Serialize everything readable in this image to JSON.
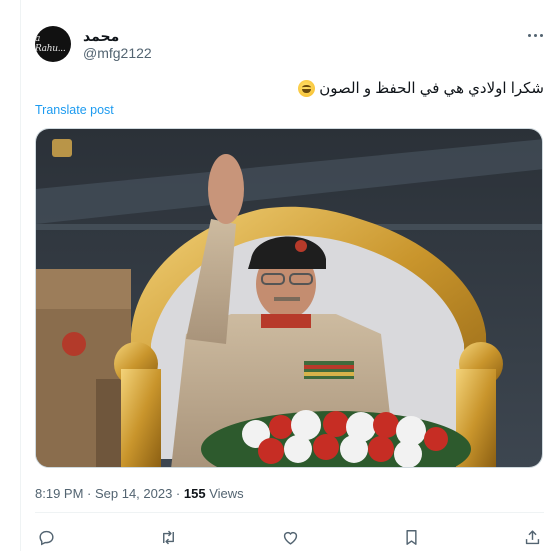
{
  "tweet": {
    "author": {
      "display_name": "محمد",
      "handle": "@mfg2122",
      "avatar_text": "a Rahu..."
    },
    "text": "شكرا اولادي هي في الحفظ و الصون",
    "emoji": "grinning-squinting-face",
    "translate_label": "Translate post",
    "timestamp": "8:19 PM · Sep 14, 2023 · ",
    "views_count": "155",
    "views_label": " Views"
  },
  "actions": {
    "reply": "reply-icon",
    "retweet": "retweet-icon",
    "like": "heart-icon",
    "bookmark": "bookmark-icon",
    "share": "share-icon"
  },
  "colors": {
    "link": "#1d9bf0",
    "secondary_text": "#536471",
    "primary_text": "#0f1419",
    "border": "#eff3f4"
  }
}
